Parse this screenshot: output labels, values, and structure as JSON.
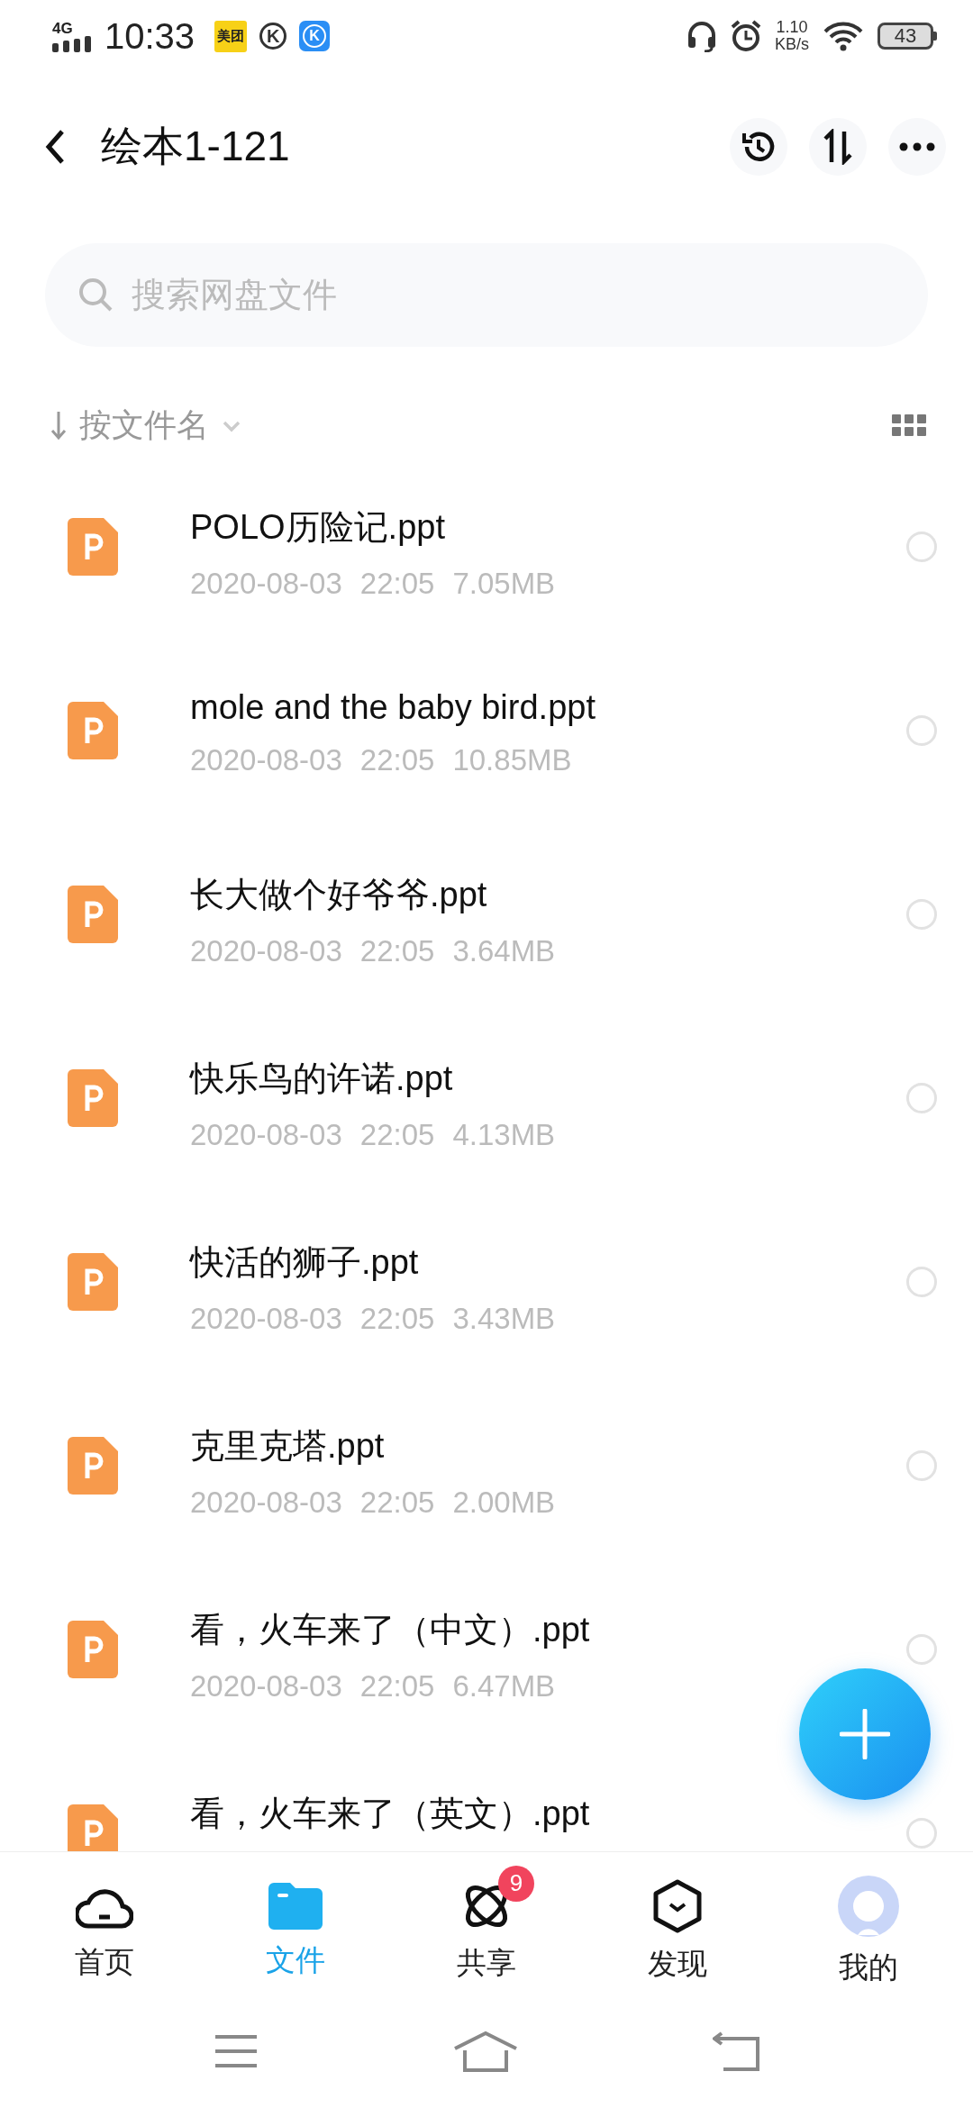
{
  "status_bar": {
    "network": "4G",
    "time": "10:33",
    "app_badges": [
      {
        "kind": "meituan",
        "text": "美团"
      },
      {
        "kind": "outline",
        "text": "K"
      },
      {
        "kind": "filled",
        "text": "K"
      }
    ],
    "speed_value": "1.10",
    "speed_unit": "KB/s",
    "battery": "43"
  },
  "header": {
    "title": "绘本1-121"
  },
  "search": {
    "placeholder": "搜索网盘文件"
  },
  "sort": {
    "label": "按文件名"
  },
  "files": [
    {
      "name": "POLO历险记.ppt",
      "date": "2020-08-03",
      "time": "22:05",
      "size": "7.05MB",
      "selected": false
    },
    {
      "name": "mole and the baby bird.ppt",
      "date": "2020-08-03",
      "time": "22:05",
      "size": "10.85MB",
      "selected": false
    },
    {
      "name": "长大做个好爷爷.ppt",
      "date": "2020-08-03",
      "time": "22:05",
      "size": "3.64MB",
      "selected": false
    },
    {
      "name": "快乐鸟的许诺.ppt",
      "date": "2020-08-03",
      "time": "22:05",
      "size": "4.13MB",
      "selected": false
    },
    {
      "name": "快活的狮子.ppt",
      "date": "2020-08-03",
      "time": "22:05",
      "size": "3.43MB",
      "selected": false
    },
    {
      "name": "克里克塔.ppt",
      "date": "2020-08-03",
      "time": "22:05",
      "size": "2.00MB",
      "selected": false
    },
    {
      "name": "看，火车来了（中文）.ppt",
      "date": "2020-08-03",
      "time": "22:05",
      "size": "6.47MB",
      "selected": false
    },
    {
      "name": "看，火车来了（英文）.ppt",
      "selected": false
    }
  ],
  "tabs": [
    {
      "kind": "home",
      "label": "首页",
      "selected": false
    },
    {
      "kind": "files",
      "label": "文件",
      "selected": true
    },
    {
      "kind": "share",
      "label": "共享",
      "selected": false,
      "badge": "9"
    },
    {
      "kind": "discover",
      "label": "发现",
      "selected": false
    },
    {
      "kind": "me",
      "label": "我的",
      "selected": false
    }
  ]
}
